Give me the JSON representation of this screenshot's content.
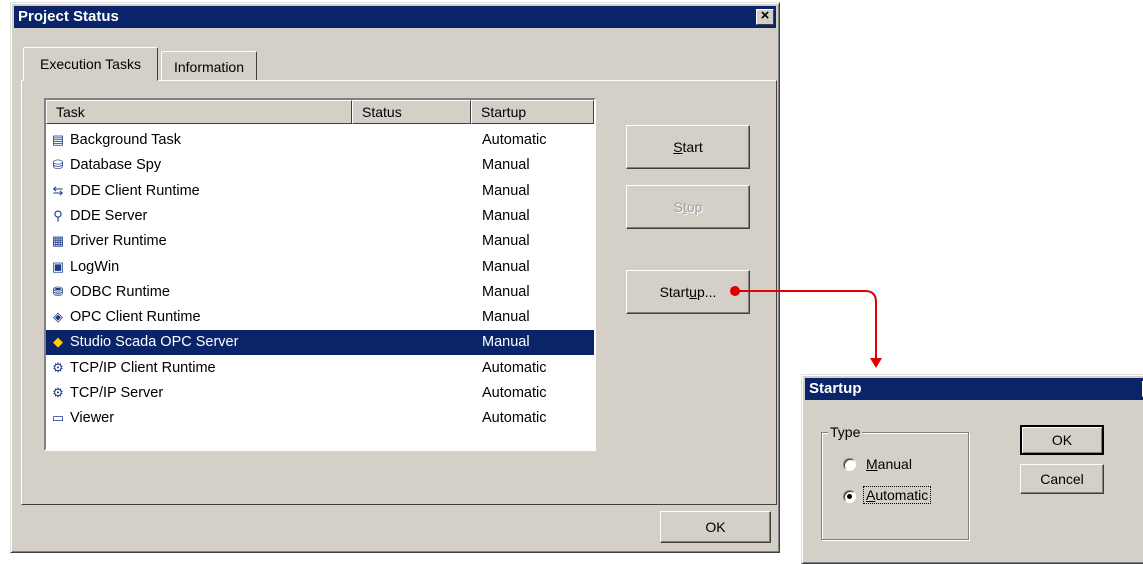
{
  "project_status": {
    "title": "Project Status",
    "tabs": [
      {
        "label": "Execution Tasks"
      },
      {
        "label": "Information"
      }
    ],
    "columns": {
      "task": "Task",
      "status": "Status",
      "startup": "Startup"
    },
    "tasks": [
      {
        "name": "Background Task",
        "status": "",
        "startup": "Automatic",
        "icon": "background-task-icon"
      },
      {
        "name": "Database Spy",
        "status": "",
        "startup": "Manual",
        "icon": "database-spy-icon"
      },
      {
        "name": "DDE Client Runtime",
        "status": "",
        "startup": "Manual",
        "icon": "dde-client-icon"
      },
      {
        "name": "DDE Server",
        "status": "",
        "startup": "Manual",
        "icon": "dde-server-icon"
      },
      {
        "name": "Driver Runtime",
        "status": "",
        "startup": "Manual",
        "icon": "driver-runtime-icon"
      },
      {
        "name": "LogWin",
        "status": "",
        "startup": "Manual",
        "icon": "logwin-icon"
      },
      {
        "name": "ODBC Runtime",
        "status": "",
        "startup": "Manual",
        "icon": "odbc-runtime-icon"
      },
      {
        "name": "OPC Client Runtime",
        "status": "",
        "startup": "Manual",
        "icon": "opc-client-icon"
      },
      {
        "name": "Studio Scada OPC Server",
        "status": "",
        "startup": "Manual",
        "icon": "opc-server-icon",
        "selected": true
      },
      {
        "name": "TCP/IP Client Runtime",
        "status": "",
        "startup": "Automatic",
        "icon": "tcpip-client-icon"
      },
      {
        "name": "TCP/IP Server",
        "status": "",
        "startup": "Automatic",
        "icon": "tcpip-server-icon"
      },
      {
        "name": "Viewer",
        "status": "",
        "startup": "Automatic",
        "icon": "viewer-icon"
      }
    ],
    "buttons": {
      "start": {
        "pre": "",
        "key": "S",
        "post": "tart"
      },
      "stop": {
        "pre": "S",
        "key": "t",
        "post": "op"
      },
      "startup": {
        "pre": "Start",
        "key": "u",
        "post": "p..."
      },
      "ok": "OK"
    }
  },
  "startup_dialog": {
    "title": "Startup",
    "group_label": "Type",
    "options": [
      {
        "pre": "",
        "key": "M",
        "post": "anual",
        "checked": false
      },
      {
        "pre": "",
        "key": "A",
        "post": "utomatic",
        "checked": true
      }
    ],
    "ok": "OK",
    "cancel": "Cancel"
  },
  "colors": {
    "titlebar": "#0a246a",
    "face": "#d4d0c8",
    "arrow": "#e00000",
    "selection": "#0a246a"
  }
}
